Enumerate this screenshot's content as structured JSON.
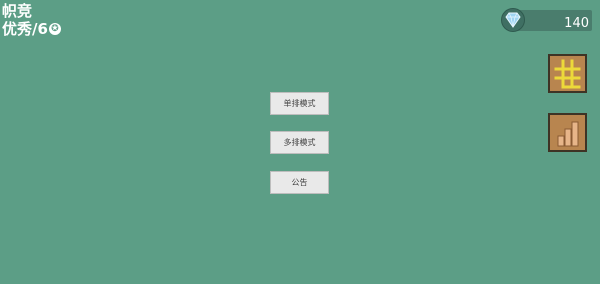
{
  "header": {
    "title": "帜竞",
    "rank_label": "优秀/6",
    "rank_icon": "star-badge-icon"
  },
  "currency": {
    "icon": "diamond-icon",
    "amount": "140"
  },
  "side_buttons": {
    "grid_icon": "grid-icon",
    "stats_icon": "bar-chart-icon"
  },
  "menu": {
    "single_mode": "单排模式",
    "multi_mode": "多排模式",
    "notice": "公告"
  },
  "colors": {
    "background": "#5c9e86",
    "side_button": "#b8854f",
    "grid_icon": "#ecd93a",
    "stats_icon": "#e7b589",
    "diamond": "#9fd4f2"
  }
}
